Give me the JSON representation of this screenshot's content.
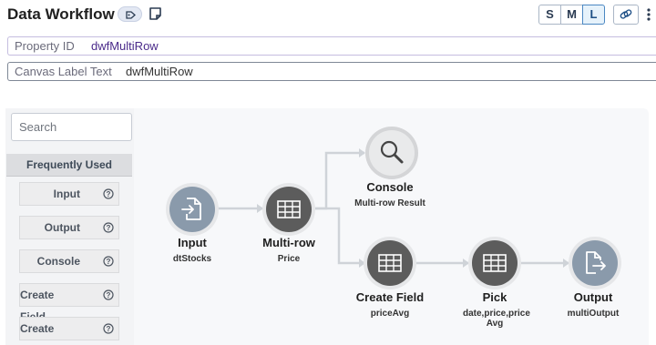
{
  "header": {
    "title": "Data Workflow",
    "sizes": [
      "S",
      "M",
      "L"
    ],
    "active_size": "L"
  },
  "properties": [
    {
      "label": "Property ID",
      "value": "dwfMultiRow"
    },
    {
      "label": "Canvas Label Text",
      "value": "dwfMultiRow"
    }
  ],
  "palette": {
    "search_placeholder": "Search",
    "section_title": "Frequently Used",
    "items": [
      "Input",
      "Output",
      "Console",
      "Create Field",
      "Create Value"
    ]
  },
  "nodes": [
    {
      "id": "input",
      "title": "Input",
      "subtitle": "dtStocks",
      "icon": "input-icon"
    },
    {
      "id": "multirow",
      "title": "Multi-row",
      "subtitle": "Price",
      "icon": "table-icon"
    },
    {
      "id": "console",
      "title": "Console",
      "subtitle": "Multi-row Result",
      "icon": "magnifier-icon"
    },
    {
      "id": "createfield",
      "title": "Create Field",
      "subtitle": "priceAvg",
      "icon": "table-icon"
    },
    {
      "id": "pick",
      "title": "Pick",
      "subtitle": "date,price,price Avg",
      "icon": "table-icon"
    },
    {
      "id": "output",
      "title": "Output",
      "subtitle": "multiOutput",
      "icon": "output-icon"
    }
  ],
  "colors": {
    "input_node": "#8a9aab",
    "process_node": "#5c5c5c",
    "console_node": "#e0e0e0",
    "output_node": "#8a9aab",
    "edge": "#cfd3d8",
    "accent_purple": "#4a2a8a"
  }
}
